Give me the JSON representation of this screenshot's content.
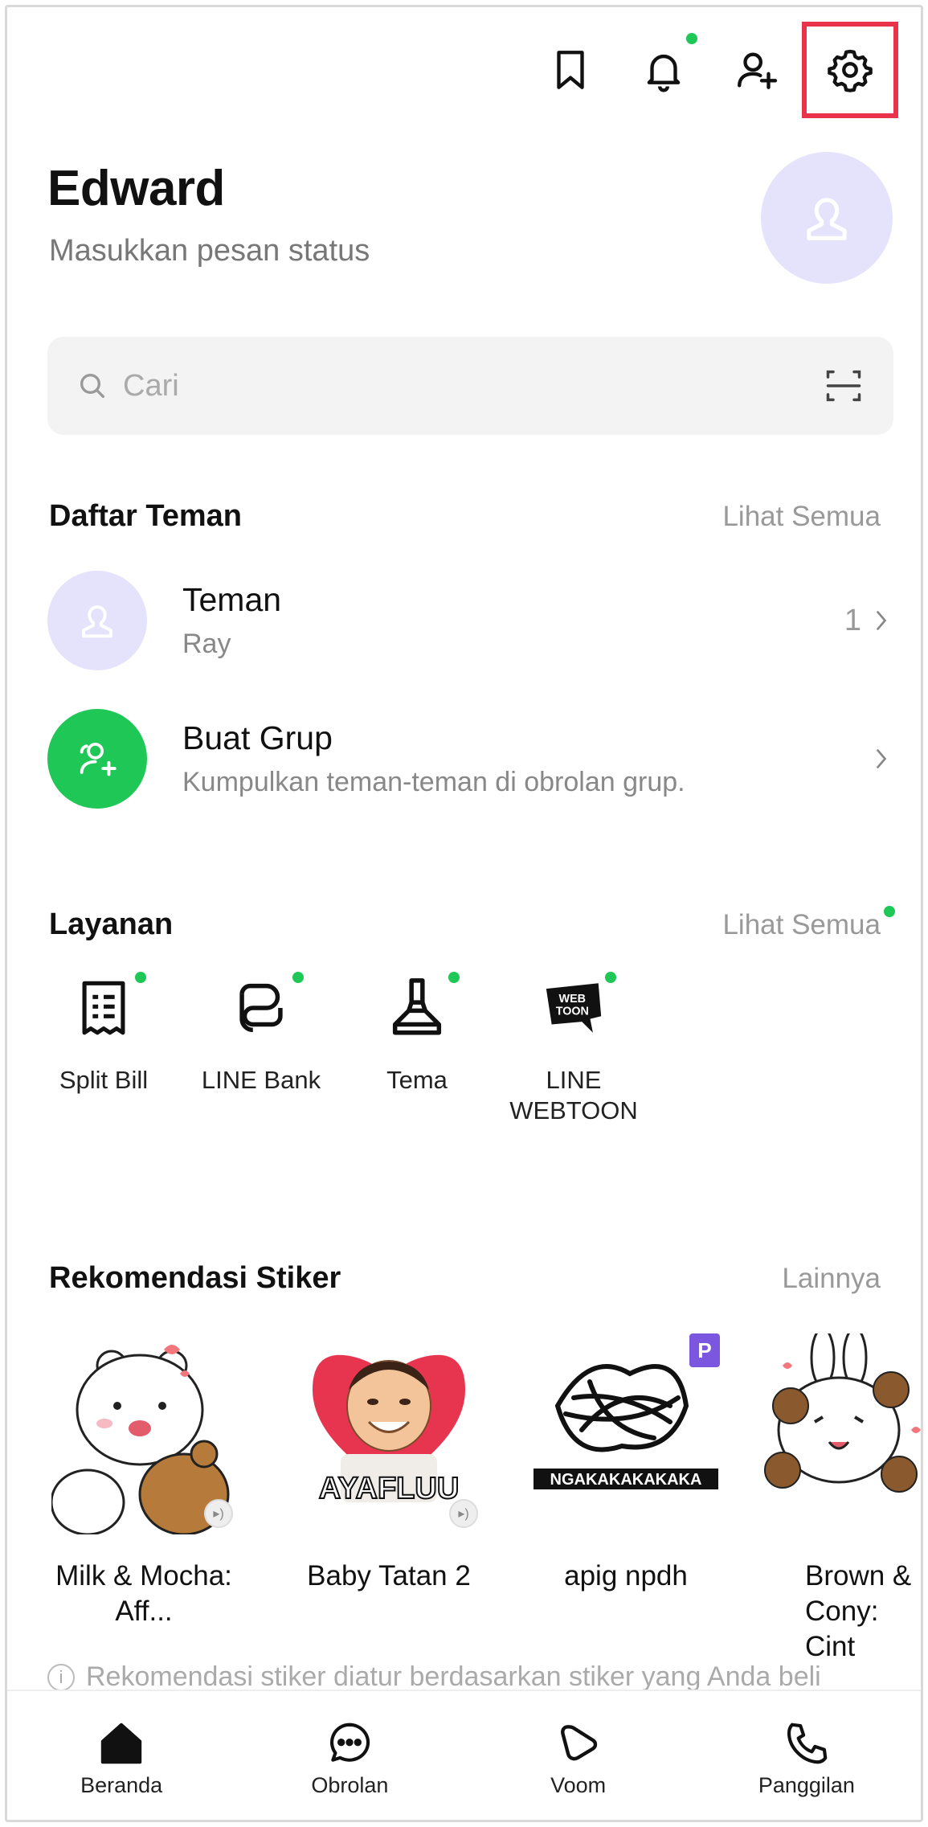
{
  "topbar": {
    "icons": [
      "bookmark-icon",
      "bell-icon",
      "add-friend-icon",
      "gear-icon"
    ],
    "highlight_color": "#e8334a",
    "notification_dot_color": "#1ec756"
  },
  "profile": {
    "name": "Edward",
    "status_placeholder": "Masukkan pesan status",
    "avatar_bg": "#e5e3fb"
  },
  "search": {
    "placeholder": "Cari"
  },
  "friends_section": {
    "title": "Daftar Teman",
    "see_all": "Lihat Semua",
    "rows": [
      {
        "title": "Teman",
        "subtitle": "Ray",
        "count": "1"
      },
      {
        "title": "Buat Grup",
        "subtitle": "Kumpulkan teman-teman di obrolan grup."
      }
    ]
  },
  "services_section": {
    "title": "Layanan",
    "see_all": "Lihat Semua",
    "items": [
      {
        "label": "Split Bill",
        "icon": "receipt-icon"
      },
      {
        "label": "LINE Bank",
        "icon": "line-bank-icon"
      },
      {
        "label": "Tema",
        "icon": "brush-icon"
      },
      {
        "label": "LINE WEBTOON",
        "icon": "webtoon-icon",
        "icon_text": "WEB TOON"
      }
    ]
  },
  "stickers_section": {
    "title": "Rekomendasi Stiker",
    "more": "Lainnya",
    "items": [
      {
        "name": "Milk & Mocha: Aff..."
      },
      {
        "name": "Baby Tatan 2",
        "caption": "AYAFLUU"
      },
      {
        "name": "apig npdh",
        "caption": "NGAKAKAKAKAKA",
        "badge": "P"
      },
      {
        "name": "Brown & Cony: Cint"
      }
    ],
    "note": "Rekomendasi stiker diatur berdasarkan stiker yang Anda beli"
  },
  "bottom_nav": {
    "items": [
      {
        "label": "Beranda",
        "icon": "home-icon"
      },
      {
        "label": "Obrolan",
        "icon": "chat-icon"
      },
      {
        "label": "Voom",
        "icon": "voom-icon"
      },
      {
        "label": "Panggilan",
        "icon": "phone-icon"
      }
    ]
  }
}
